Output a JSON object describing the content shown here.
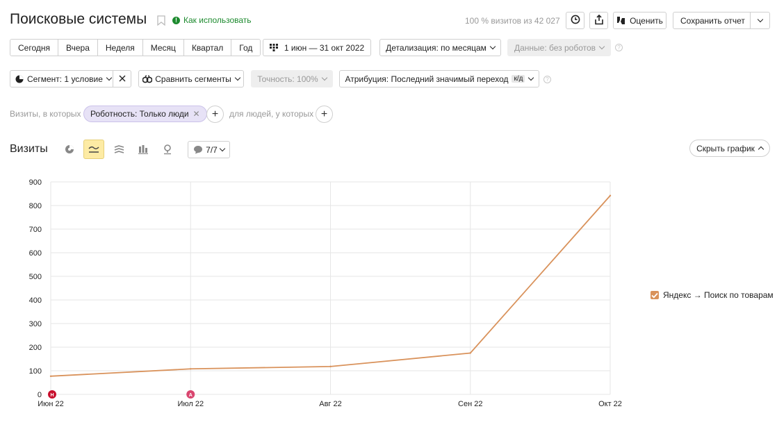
{
  "header": {
    "title": "Поисковые системы",
    "help_link": "Как использовать",
    "visits_share": "100 % визитов из 42 027",
    "rate_label": "Оценить",
    "save_report_label": "Сохранить отчет"
  },
  "periods": [
    "Сегодня",
    "Вчера",
    "Неделя",
    "Месяц",
    "Квартал",
    "Год"
  ],
  "date_range": "1 июн — 31 окт 2022",
  "detail": "Детализация: по месяцам",
  "data_filter": "Данные: без роботов",
  "segment": "Сегмент: 1 условие",
  "compare_segments": "Сравнить сегменты",
  "accuracy": "Точность: 100%",
  "attribution": {
    "label": "Атрибуция: Последний значимый переход",
    "badge": "к/д"
  },
  "filters": {
    "prefix": "Визиты, в которых",
    "chip": "Роботность: Только люди",
    "people_label": "для людей, у которых"
  },
  "chart_controls": {
    "title": "Визиты",
    "annotations_count": "7/7",
    "hide_chart_label": "Скрыть график"
  },
  "colors": {
    "series": "#d9925b",
    "active_view": "#fdeba4",
    "filter_chip": "#e7e2f6",
    "help_green": "#1c8a2e"
  },
  "chart_data": {
    "type": "line",
    "title": "",
    "xlabel": "",
    "ylabel": "",
    "categories": [
      "Июн 22",
      "Июл 22",
      "Авг 22",
      "Сен 22",
      "Окт 22"
    ],
    "ylim": [
      0,
      900
    ],
    "yticks": [
      0,
      100,
      200,
      300,
      400,
      500,
      600,
      700,
      800,
      900
    ],
    "grid": true,
    "legend_position": "right",
    "series": [
      {
        "name": "Яндекс → Поиск по товарам",
        "values": [
          77,
          108,
          118,
          175,
          842
        ]
      }
    ],
    "markers": [
      {
        "category": "Июн 22",
        "label": "Н",
        "color": "#c8102e"
      },
      {
        "category": "Июл 22",
        "label": "А",
        "color": "#d9466f"
      }
    ]
  }
}
